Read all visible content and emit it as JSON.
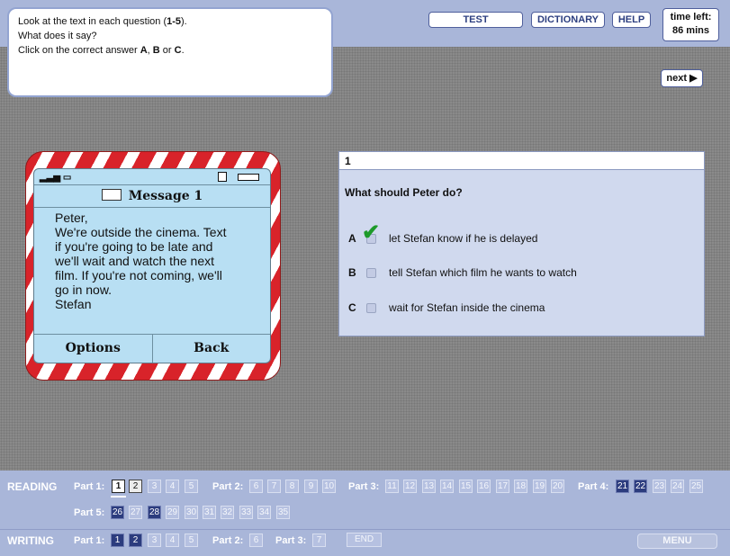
{
  "instructions": {
    "line1_pre": "Look at the text in each question (",
    "line1_bold": "1-5",
    "line1_post": ").",
    "line2": "What does it say?",
    "line3_pre": "Click on the correct answer ",
    "line3_a": "A",
    "line3_sep1": ", ",
    "line3_b": "B",
    "line3_sep2": " or ",
    "line3_c": "C",
    "line3_post": "."
  },
  "toolbar": {
    "test": "TEST",
    "dictionary": "DICTIONARY",
    "help": "HELP"
  },
  "timer": {
    "label": "time left:",
    "value": "86 mins"
  },
  "next_label": "next ▶",
  "phone": {
    "title": "Message 1",
    "lines": [
      "Peter,",
      "We're outside the cinema. Text",
      "if you're going to be late and",
      "we'll wait and watch the next",
      "film. If you're not coming, we'll",
      "go in now.",
      "Stefan"
    ],
    "options": "Options",
    "back": "Back"
  },
  "question": {
    "number": "1",
    "text": "What should Peter do?",
    "options": [
      {
        "letter": "A",
        "text": "let Stefan know if he is delayed",
        "selected": true
      },
      {
        "letter": "B",
        "text": "tell Stefan which film he wants to watch",
        "selected": false
      },
      {
        "letter": "C",
        "text": "wait for Stefan inside the cinema",
        "selected": false
      }
    ]
  },
  "nav": {
    "reading": "READING",
    "writing": "WRITING",
    "part1": "Part 1:",
    "part2": "Part 2:",
    "part3": "Part 3:",
    "part4": "Part 4:",
    "part5": "Part 5:",
    "reading_items": [
      "1",
      "2",
      "3",
      "4",
      "5",
      "6",
      "7",
      "8",
      "9",
      "10",
      "11",
      "12",
      "13",
      "14",
      "15",
      "16",
      "17",
      "18",
      "19",
      "20",
      "21",
      "22",
      "23",
      "24",
      "25",
      "26",
      "27",
      "28",
      "29",
      "30",
      "31",
      "32",
      "33",
      "34",
      "35"
    ],
    "writing_items": [
      "1",
      "2",
      "3",
      "4",
      "5",
      "6",
      "7"
    ],
    "end": "END",
    "menu": "MENU"
  }
}
